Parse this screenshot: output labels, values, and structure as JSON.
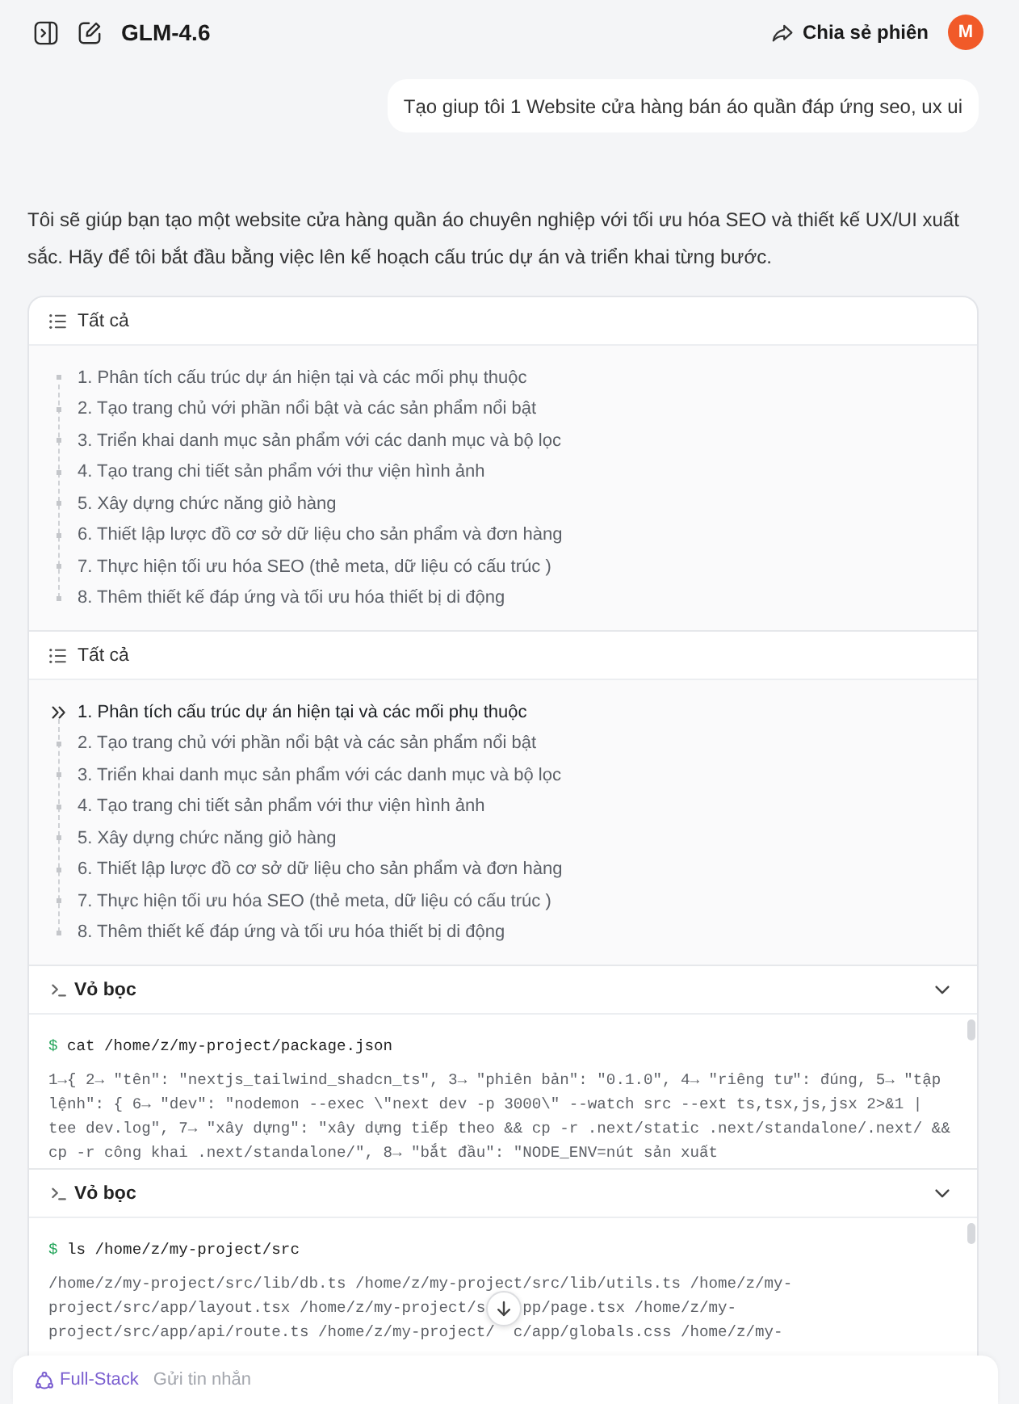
{
  "top_bar": {
    "model_name": "GLM-4.6",
    "share_label": "Chia sẻ phiên",
    "avatar_letter": "M"
  },
  "user_message": "Tạo giup tôi 1 Website cửa hàng bán áo quần đáp ứng seo, ux ui",
  "assistant_message": "Tôi sẽ giúp bạn tạo một website cửa hàng quần áo chuyên nghiệp với tối ưu hóa SEO và thiết kế UX/UI xuất sắc. Hãy để tôi bắt đầu bằng việc lên kế hoạch cấu trúc dự án và triển khai từng bước.",
  "blocks": [
    {
      "kind": "todo",
      "title": "Tất cả",
      "items": [
        {
          "text": "1. Phân tích cấu trúc dự án hiện tại và các mối phụ thuộc",
          "in_progress": false
        },
        {
          "text": "2. Tạo trang chủ với phần nổi bật và các sản phẩm nổi bật",
          "in_progress": false
        },
        {
          "text": "3. Triển khai danh mục sản phẩm với các danh mục và bộ lọc",
          "in_progress": false
        },
        {
          "text": "4. Tạo trang chi tiết sản phẩm với thư viện hình ảnh",
          "in_progress": false
        },
        {
          "text": "5. Xây dựng chức năng giỏ hàng",
          "in_progress": false
        },
        {
          "text": "6. Thiết lập lược đồ cơ sở dữ liệu cho sản phẩm và đơn hàng",
          "in_progress": false
        },
        {
          "text": "7. Thực hiện tối ưu hóa SEO (thẻ meta, dữ liệu có cấu trúc )",
          "in_progress": false
        },
        {
          "text": "8. Thêm thiết kế đáp ứng và tối ưu hóa thiết bị di động",
          "in_progress": false
        }
      ]
    },
    {
      "kind": "todo",
      "title": "Tất cả",
      "items": [
        {
          "text": "1. Phân tích cấu trúc dự án hiện tại và các mối phụ thuộc",
          "in_progress": true
        },
        {
          "text": "2. Tạo trang chủ với phần nổi bật và các sản phẩm nổi bật",
          "in_progress": false
        },
        {
          "text": "3. Triển khai danh mục sản phẩm với các danh mục và bộ lọc",
          "in_progress": false
        },
        {
          "text": "4. Tạo trang chi tiết sản phẩm với thư viện hình ảnh",
          "in_progress": false
        },
        {
          "text": "5. Xây dựng chức năng giỏ hàng",
          "in_progress": false
        },
        {
          "text": "6. Thiết lập lược đồ cơ sở dữ liệu cho sản phẩm và đơn hàng",
          "in_progress": false
        },
        {
          "text": "7. Thực hiện tối ưu hóa SEO (thẻ meta, dữ liệu có cấu trúc )",
          "in_progress": false
        },
        {
          "text": "8. Thêm thiết kế đáp ứng và tối ưu hóa thiết bị di động",
          "in_progress": false
        }
      ]
    },
    {
      "kind": "shell",
      "title": "Vỏ bọc",
      "prompt": "$",
      "command": "cat /home/z/my-project/package.json",
      "output": [
        [
          "1→{ 2→ \"tên\": \"nextjs_tailwind_shadcn_ts\", 3→ \"phiên bản\": \"0.1.0\", 4→ \"riêng tư\": đúng, 5→ \"tập"
        ],
        [
          "lệnh\": { 6→ \"dev\": \"nodemon --exec \\\"next dev -p 3000\\\" --watch src --ext ts,tsx,js,jsx 2>&1 |"
        ],
        [
          "tee dev.log\", 7→ \"xây dựng\": \"xây dựng tiếp theo && cp -r .next/static .next/standalone/.next/ &&"
        ],
        [
          "cp -r công khai .next/standalone/\", 8→ \"bắt đầu\": \"NODE_ENV=nút sản xuất"
        ]
      ]
    },
    {
      "kind": "shell",
      "title": "Vỏ bọc",
      "prompt": "$",
      "command": "ls /home/z/my-project/src",
      "output": [
        [
          "/home/z/my-project/src/lib/db.ts /home/z/my-project/src/lib/utils.ts /home/z/my-"
        ],
        [
          "project/src/app/layout.tsx /home/z/my-project/s",
          "pp/page.tsx /home/z/my-"
        ],
        [
          "project/src/app/api/route.ts /home/z/my-project/",
          "c/app/globals.css /home/z/my-"
        ]
      ]
    }
  ],
  "composer": {
    "mode": "Full-Stack",
    "placeholder": "Gửi tin nhắn"
  }
}
